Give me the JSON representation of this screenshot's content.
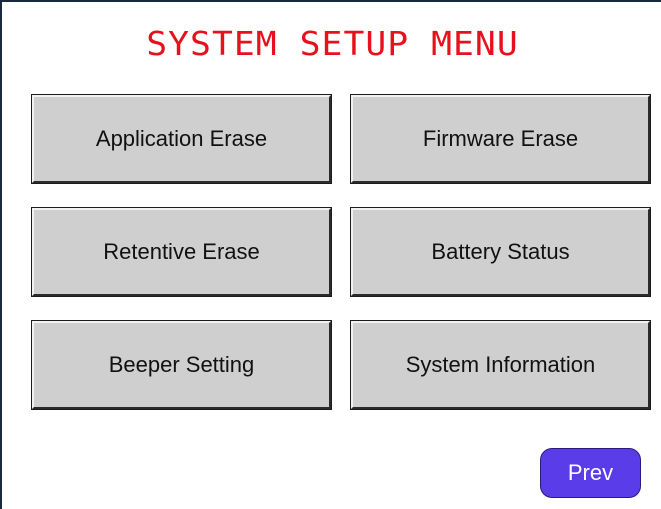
{
  "title": "SYSTEM SETUP MENU",
  "buttons": {
    "application_erase": "Application Erase",
    "firmware_erase": "Firmware Erase",
    "retentive_erase": "Retentive Erase",
    "battery_status": "Battery Status",
    "beeper_setting": "Beeper Setting",
    "system_information": "System Information"
  },
  "nav": {
    "prev": "Prev"
  },
  "colors": {
    "title": "#e8101c",
    "button_face": "#cfcfcf",
    "prev_button": "#5a3ce8"
  }
}
